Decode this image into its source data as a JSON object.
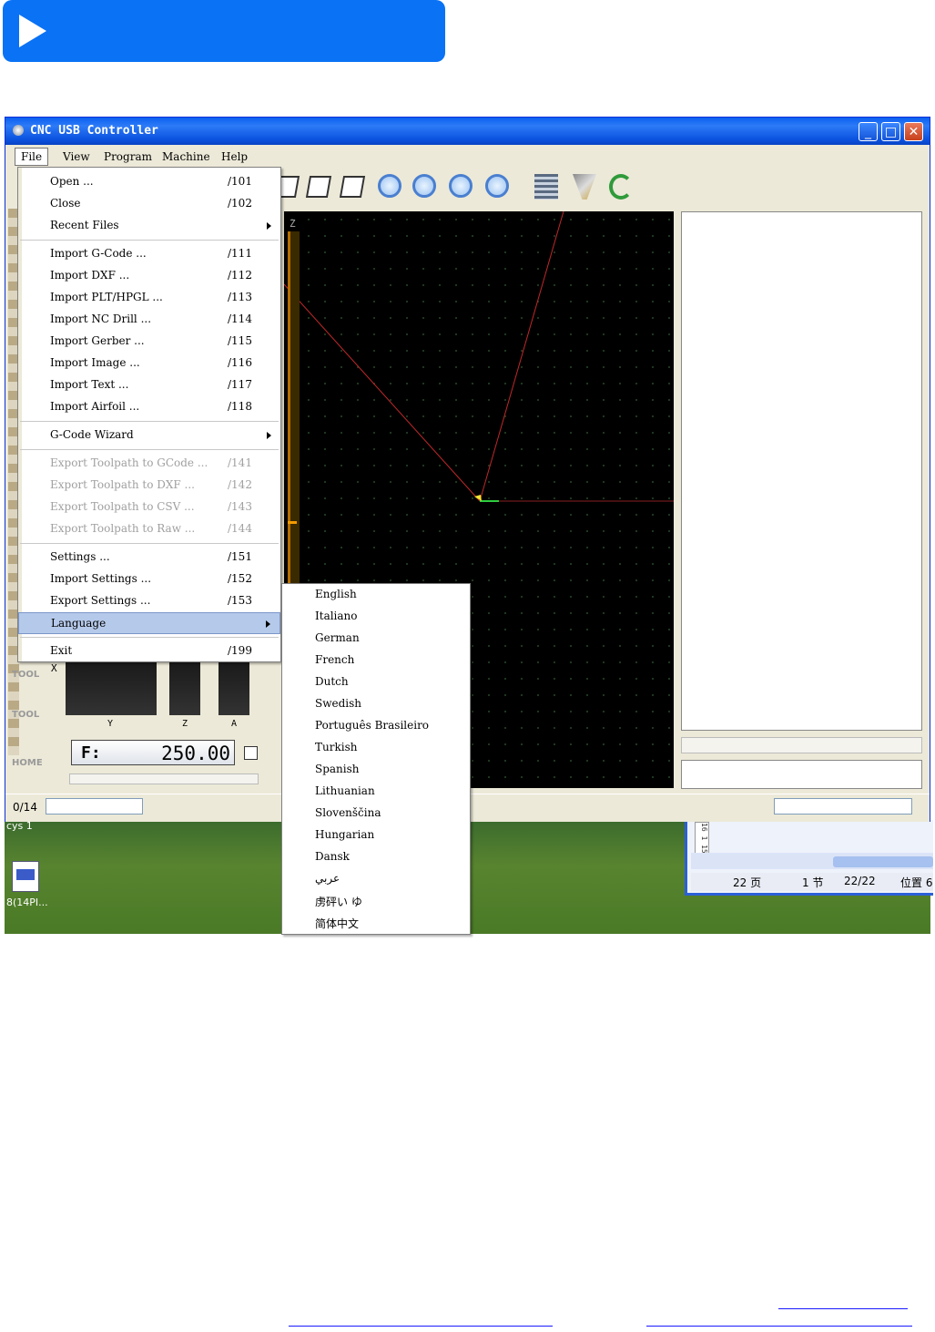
{
  "window": {
    "title": "CNC USB Controller",
    "controls": {
      "minimize": "_",
      "maximize": "□",
      "close": "✕"
    }
  },
  "menubar": {
    "items": [
      "File",
      "View",
      "Program",
      "Machine",
      "Help"
    ]
  },
  "file_menu": {
    "groups": [
      [
        {
          "label": "Open ...",
          "accel": "/101"
        },
        {
          "label": "Close",
          "accel": "/102"
        },
        {
          "label": "Recent Files",
          "accel": "",
          "submenu": true
        }
      ],
      [
        {
          "label": "Import G-Code ...",
          "accel": "/111"
        },
        {
          "label": "Import DXF ...",
          "accel": "/112"
        },
        {
          "label": "Import PLT/HPGL ...",
          "accel": "/113"
        },
        {
          "label": "Import NC Drill ...",
          "accel": "/114"
        },
        {
          "label": "Import Gerber ...",
          "accel": "/115"
        },
        {
          "label": "Import Image ...",
          "accel": "/116"
        },
        {
          "label": "Import Text ...",
          "accel": "/117"
        },
        {
          "label": "Import Airfoil ...",
          "accel": "/118"
        }
      ],
      [
        {
          "label": "G-Code Wizard",
          "accel": "",
          "submenu": true
        }
      ],
      [
        {
          "label": "Export Toolpath to GCode ...",
          "accel": "/141",
          "disabled": true
        },
        {
          "label": "Export Toolpath to DXF ...",
          "accel": "/142",
          "disabled": true
        },
        {
          "label": "Export Toolpath to CSV ...",
          "accel": "/143",
          "disabled": true
        },
        {
          "label": "Export Toolpath to Raw ...",
          "accel": "/144",
          "disabled": true
        }
      ],
      [
        {
          "label": "Settings ...",
          "accel": "/151"
        },
        {
          "label": "Import Settings ...",
          "accel": "/152"
        },
        {
          "label": "Export Settings ...",
          "accel": "/153"
        },
        {
          "label": "Language",
          "accel": "",
          "submenu": true,
          "selected": true
        }
      ],
      [
        {
          "label": "Exit",
          "accel": "/199"
        }
      ]
    ]
  },
  "language_menu": {
    "items": [
      "English",
      "Italiano",
      "German",
      "French",
      "Dutch",
      "Swedish",
      "Português Brasileiro",
      "Turkish",
      "Spanish",
      "Lithuanian",
      "Slovenščina",
      "Hungarian",
      "Dansk",
      "عربي",
      "虏砰い ゆ",
      "简体中文"
    ]
  },
  "viewport": {
    "z_axis_label": "Z"
  },
  "controls": {
    "feed_label": "F:",
    "feed_value": "250.00",
    "axis_labels": {
      "x": "X",
      "y": "Y",
      "z": "Z",
      "a": "A"
    },
    "side_labels": [
      "TOOL",
      "TOOL",
      "HOME"
    ]
  },
  "statusbar": {
    "count": "0/14"
  },
  "desktop": {
    "label_top": "cys 1",
    "label_icon": "8(14PI..."
  },
  "word_status": {
    "page": "22 页",
    "section": "1 节",
    "pages": "22/22",
    "position": "位置 6",
    "ruler": "16 1 15"
  },
  "colors": {
    "banner": "#0a72f5",
    "title_bar": "#0b52df",
    "menu_selected": "#b5c9ea",
    "toolpath": "#c0282b"
  }
}
